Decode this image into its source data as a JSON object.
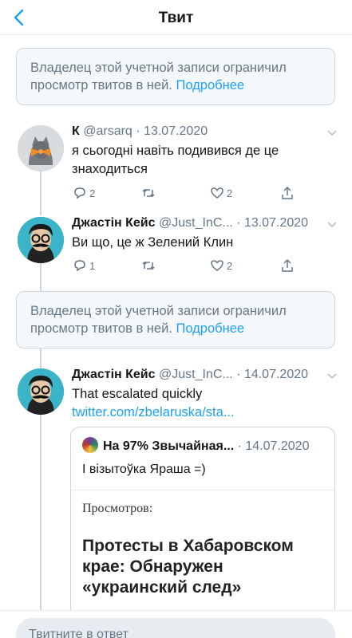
{
  "header": {
    "title": "Твит"
  },
  "notices": [
    {
      "text": "Владелец этой учетной записи ограничил просмотр твитов в ней.",
      "more": "Подробнее"
    },
    {
      "text": "Владелец этой учетной записи ограничил просмотр твитов в ней.",
      "more": "Подробнее"
    }
  ],
  "tweets": [
    {
      "name": "К",
      "handle": "@arsarq",
      "date": "13.07.2020",
      "text": "я сьогодні навіть подивився де це знаходиться",
      "replies": "2",
      "retweets": "",
      "likes": "2"
    },
    {
      "name": "Джастін Кейс",
      "handle": "@Just_InC...",
      "date": "13.07.2020",
      "text": "Ви що, це ж Зелений Клин",
      "replies": "1",
      "retweets": "",
      "likes": "2"
    },
    {
      "name": "Джастін Кейс",
      "handle": "@Just_InC...",
      "date": "14.07.2020",
      "text": "That escalated quickly",
      "link": "twitter.com/zbelaruska/sta..."
    }
  ],
  "quote": {
    "name": "На 97% Звычайная...",
    "date": "14.07.2020",
    "text": "І візытоўка Яраша =)",
    "views": "Просмотров:",
    "headline": "Протесты в Хабаровском крае: Обнаружен «украинский след»"
  },
  "reply": {
    "placeholder": "Твитните в ответ"
  },
  "colors": {
    "accent": "#1da1f2",
    "muted": "#657786",
    "border": "#ccd6dd"
  }
}
